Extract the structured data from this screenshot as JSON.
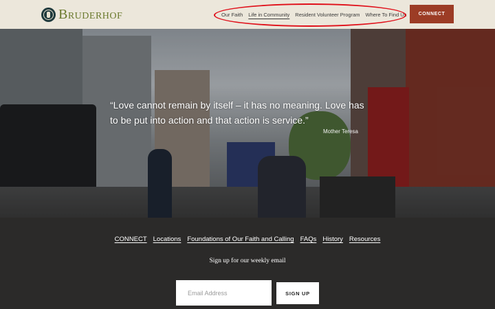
{
  "header": {
    "logo_text": "Bruderhof",
    "nav": [
      {
        "label": "Our Faith"
      },
      {
        "label": "Life in Community"
      },
      {
        "label": "Resident Volunteer Program"
      },
      {
        "label": "Where To Find Us"
      }
    ],
    "connect_label": "CONNECT"
  },
  "hero": {
    "quote": "“Love cannot remain by itself – it has no meaning. Love has to be put into action and that action is service.”",
    "author": "Mother Teresa"
  },
  "footer": {
    "links": [
      {
        "label": "CONNECT"
      },
      {
        "label": "Locations"
      },
      {
        "label": "Foundations of Our Faith and Calling"
      },
      {
        "label": "FAQs"
      },
      {
        "label": "History"
      },
      {
        "label": "Resources"
      }
    ],
    "signup_title": "Sign up for our weekly email",
    "email_placeholder": "Email Address",
    "signup_label": "SIGN UP"
  },
  "colors": {
    "header_bg": "#ece7db",
    "connect_bg": "#9c3c25",
    "footer_bg": "#2b2a29",
    "annotation": "#e0101a"
  }
}
